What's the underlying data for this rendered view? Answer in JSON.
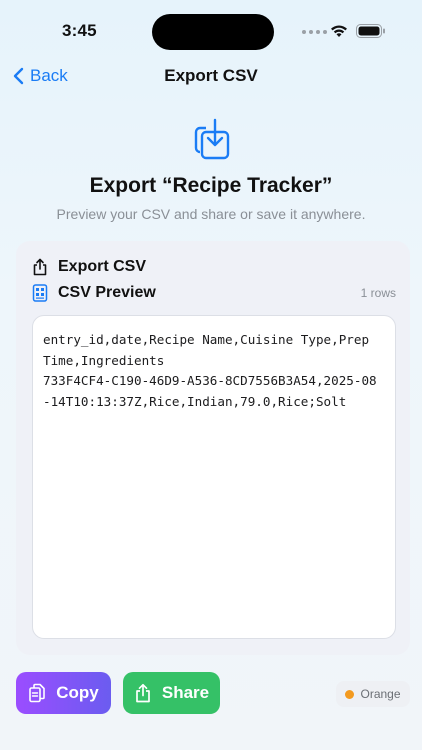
{
  "status": {
    "time": "3:45"
  },
  "nav": {
    "back_label": "Back",
    "title": "Export CSV"
  },
  "header": {
    "title": "Export “Recipe Tracker”",
    "subtitle": "Preview your CSV and share or save it anywhere."
  },
  "card": {
    "export_label": "Export CSV",
    "preview_label": "CSV Preview",
    "rows_count": "1 rows",
    "csv_text": "entry_id,date,Recipe Name,Cuisine Type,Prep Time,Ingredients\n733F4CF4-C190-46D9-A536-8CD7556B3A54,2025-08-14T10:13:37Z,Rice,Indian,79.0,Rice;Solt"
  },
  "actions": {
    "copy_label": "Copy",
    "share_label": "Share"
  },
  "tag": {
    "label": "Orange",
    "color": "#f39a1f"
  },
  "colors": {
    "accent": "#1a7cf5",
    "share": "#35c167",
    "copy_start": "#9b4dff",
    "copy_end": "#6b5cf0"
  },
  "icons": [
    "chevron-left-icon",
    "wifi-icon",
    "battery-icon",
    "export-tray-icon",
    "share-icon",
    "csv-file-icon",
    "copy-icon"
  ]
}
